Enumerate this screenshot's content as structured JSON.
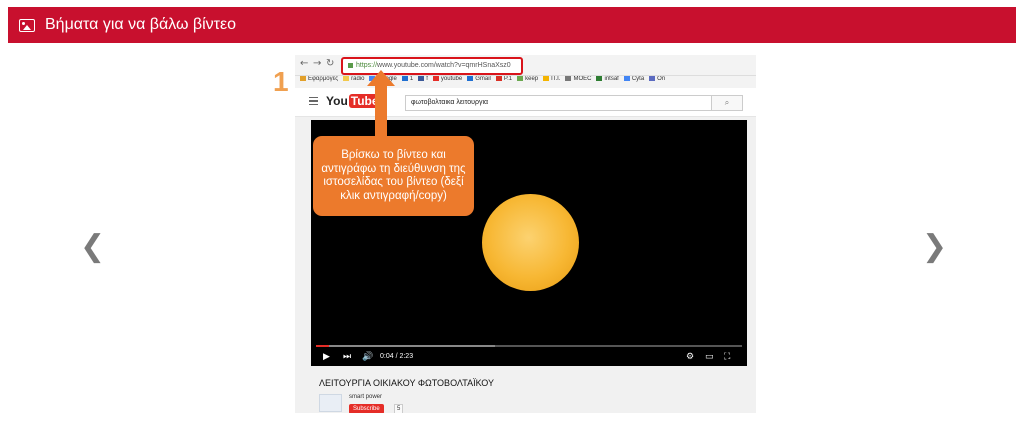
{
  "header": {
    "title": "Βήματα για να βάλω βίντεο",
    "icon": "image-icon"
  },
  "carousel": {
    "prev_icon": "chevron-left-icon",
    "next_icon": "chevron-right-icon",
    "prev_glyph": "❮",
    "next_glyph": "❯"
  },
  "browser": {
    "url_scheme": "https://",
    "url_host": "www.youtube.com",
    "url_path": "/watch?v=qmrHSnaXsz0",
    "bookmarks": [
      "Εφαρμογές",
      "radio",
      "Google",
      "1",
      "f",
      "youtube",
      "Gmail",
      "P.1",
      "keep",
      "Π.Ι.",
      "MOEC",
      "intsaf",
      "Cyta",
      "On"
    ]
  },
  "youtube": {
    "logo_you": "You",
    "logo_tube": "Tube",
    "search_query": "φωτοβολταικα λειτουργια",
    "time": "0:04 / 2:23",
    "progress_fraction": 0.42,
    "played_fraction": 0.03,
    "video_title": "ΛΕΙΤΟΥΡΓΙΑ ΟΙΚΙΑΚΟΥ ΦΩΤΟΒΟΛΤΑΪΚΟΥ",
    "channel_name": "smart power",
    "subscribe_label": "Subscribe",
    "subscriber_count": "5"
  },
  "annotation": {
    "step_number": "1",
    "callout_text": "Βρίσκω το βίντεο και αντιγράφω τη διεύθυνση της ιστοσελίδας του βίντεο (δεξί κλικ αντιγραφή/copy)",
    "color": "#ec7a2c"
  },
  "colors": {
    "header_bg": "#c8102e",
    "youtube_red": "#e52d27",
    "url_highlight": "#d9141b"
  }
}
